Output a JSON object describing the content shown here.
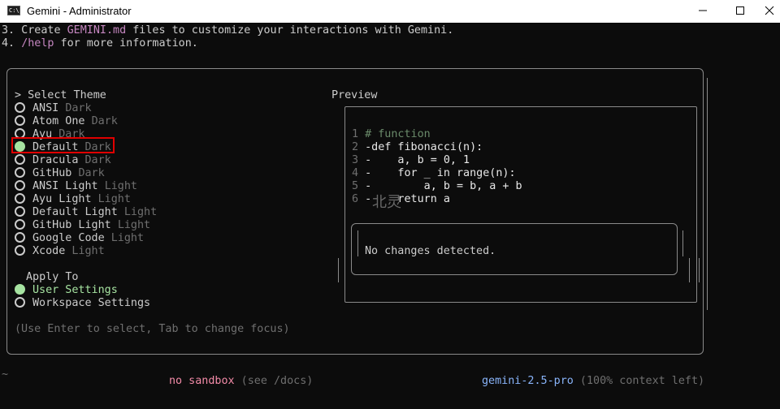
{
  "window": {
    "title": "Gemini - Administrator",
    "icon_text": "C:\\"
  },
  "intro": {
    "line3_prefix": "3. Create ",
    "line3_file": "GEMINI.md",
    "line3_suffix": " files to customize your interactions with Gemini.",
    "line4_prefix": "4. ",
    "line4_cmd": "/help",
    "line4_suffix": " for more information."
  },
  "theme_panel": {
    "heading": "> Select Theme",
    "themes": [
      {
        "name": "ANSI",
        "type": "Dark",
        "selected": false
      },
      {
        "name": "Atom One",
        "type": "Dark",
        "selected": false
      },
      {
        "name": "Ayu",
        "type": "Dark",
        "selected": false
      },
      {
        "name": "Default",
        "type": "Dark",
        "selected": true
      },
      {
        "name": "Dracula",
        "type": "Dark",
        "selected": false
      },
      {
        "name": "GitHub",
        "type": "Dark",
        "selected": false
      },
      {
        "name": "ANSI Light",
        "type": "Light",
        "selected": false
      },
      {
        "name": "Ayu Light",
        "type": "Light",
        "selected": false
      },
      {
        "name": "Default Light",
        "type": "Light",
        "selected": false
      },
      {
        "name": "GitHub Light",
        "type": "Light",
        "selected": false
      },
      {
        "name": "Google Code",
        "type": "Light",
        "selected": false
      },
      {
        "name": "Xcode",
        "type": "Light",
        "selected": false
      }
    ],
    "apply_heading": "Apply To",
    "apply_options": [
      {
        "label": "User Settings",
        "selected": true
      },
      {
        "label": "Workspace Settings",
        "selected": false
      }
    ],
    "hint": "(Use Enter to select, Tab to change focus)"
  },
  "preview": {
    "heading": "Preview",
    "code_lines": [
      {
        "num": "1",
        "text": " # function"
      },
      {
        "num": "2",
        "text": " -def fibonacci(n):"
      },
      {
        "num": "3",
        "text": " -    a, b = 0, 1"
      },
      {
        "num": "4",
        "text": " -    for _ in range(n):"
      },
      {
        "num": "5",
        "text": " -        a, b = b, a + b"
      },
      {
        "num": "6",
        "text": " -    return a"
      }
    ],
    "diff_message": "No changes detected.",
    "watermark": "北灵"
  },
  "footer": {
    "cwd": "~",
    "sandbox": "no sandbox",
    "sandbox_hint": " (see /docs)",
    "model": "gemini-2.5-pro",
    "context": " (100% context left)"
  },
  "colors": {
    "background": "#0c0c0c",
    "selected_green": "#a6e3a1",
    "file_purple": "#c586c0",
    "highlight_red": "#e00000",
    "sandbox_red": "#f38ba8",
    "model_blue": "#89b4fa"
  }
}
